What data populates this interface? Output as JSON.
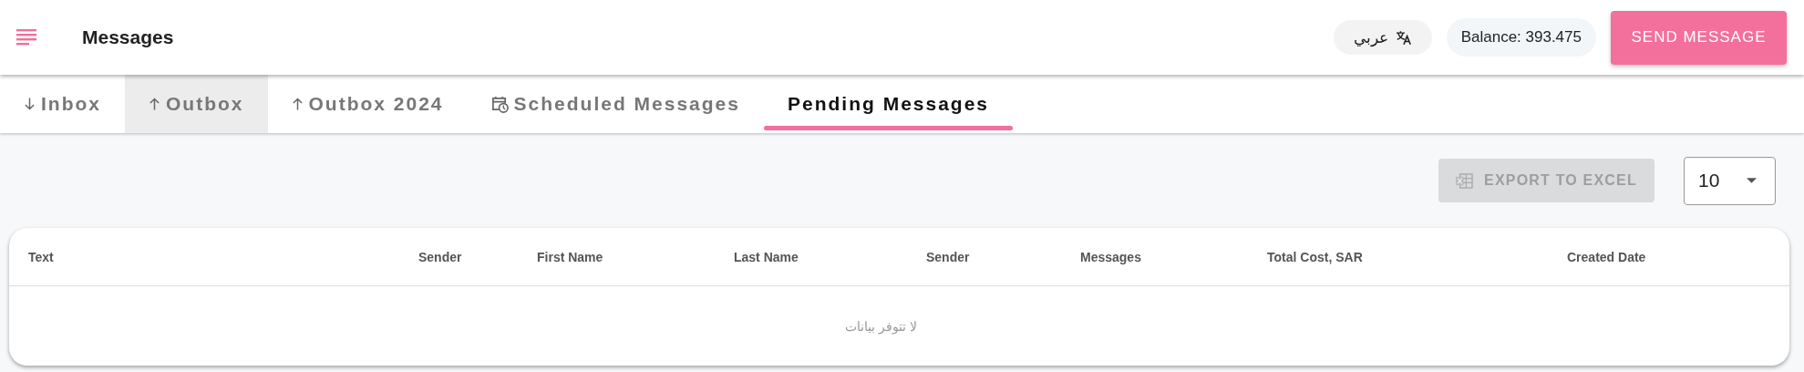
{
  "header": {
    "title": "Messages",
    "language": "عربي",
    "balance": "Balance: 393.475",
    "send_button": "SEND MESSAGE"
  },
  "tabs": [
    {
      "label": "Inbox",
      "kind": "down",
      "selected": false,
      "hovered": false
    },
    {
      "label": "Outbox",
      "kind": "up",
      "selected": false,
      "hovered": true
    },
    {
      "label": "Outbox 2024",
      "kind": "up",
      "selected": false,
      "hovered": false
    },
    {
      "label": "Scheduled Messages",
      "kind": "scheduled",
      "selected": false,
      "hovered": false
    },
    {
      "label": "Pending Messages",
      "kind": "plain",
      "selected": true,
      "hovered": false
    }
  ],
  "toolbar": {
    "export_button": {
      "label": "EXPORT TO EXCEL",
      "disabled": true
    },
    "page_size": "10"
  },
  "table": {
    "columns": [
      "Text",
      "Sender",
      "First Name",
      "Last Name",
      "Sender",
      "Messages",
      "Total Cost, SAR",
      "Created Date"
    ],
    "empty_message": "لا تتوفر بيانات"
  }
}
